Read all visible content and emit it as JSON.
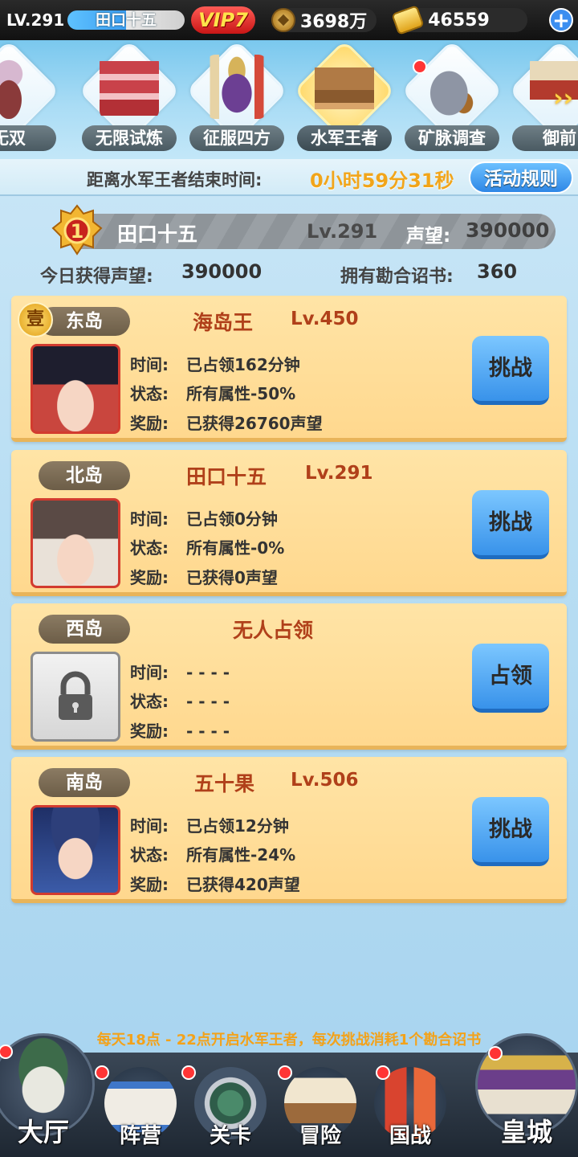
{
  "topbar": {
    "level": "LV.291",
    "player_name": "田口十五",
    "vip": "VIP7",
    "copper": "3698万",
    "gold": "46559",
    "plus": "+"
  },
  "carousel": {
    "items": [
      {
        "label": "无双"
      },
      {
        "label": "无限试炼"
      },
      {
        "label": "征服四方"
      },
      {
        "label": "水军王者"
      },
      {
        "label": "矿脉调查"
      },
      {
        "label": "御前"
      }
    ]
  },
  "timer": {
    "label": "距离水军王者结束时间:",
    "value": "0小时59分31秒",
    "rules_button": "活动规则"
  },
  "me": {
    "rank": "1",
    "name": "田口十五",
    "level": "Lv.291",
    "fame_label": "声望:",
    "fame": "390000",
    "today_label": "今日获得声望:",
    "today_value": "390000",
    "edict_label": "拥有勘合诏书:",
    "edict_value": "360"
  },
  "islands": [
    {
      "rank_coin": "壹",
      "name": "东岛",
      "owner": "海岛王",
      "owner_level": "Lv.450",
      "time_label": "时间:",
      "time": "已占领162分钟",
      "status_label": "状态:",
      "status": "所有属性-50%",
      "reward_label": "奖励:",
      "reward": "已获得26760声望",
      "button": "挑战"
    },
    {
      "name": "北岛",
      "owner": "田口十五",
      "owner_level": "Lv.291",
      "time_label": "时间:",
      "time": "已占领0分钟",
      "status_label": "状态:",
      "status": "所有属性-0%",
      "reward_label": "奖励:",
      "reward": "已获得0声望",
      "button": "挑战"
    },
    {
      "name": "西岛",
      "owner": "无人占领",
      "time_label": "时间:",
      "time": "- - - -",
      "status_label": "状态:",
      "status": "- - - -",
      "reward_label": "奖励:",
      "reward": "- - - -",
      "button": "占领"
    },
    {
      "name": "南岛",
      "owner": "五十果",
      "owner_level": "Lv.506",
      "time_label": "时间:",
      "time": "已占领12分钟",
      "status_label": "状态:",
      "status": "所有属性-24%",
      "reward_label": "奖励:",
      "reward": "已获得420声望",
      "button": "挑战"
    }
  ],
  "notice": "每天18点 - 22点开启水军王者，每次挑战消耗1个勘合诏书",
  "nav": [
    {
      "label": "大厅"
    },
    {
      "label": "阵营"
    },
    {
      "label": "关卡"
    },
    {
      "label": "冒险"
    },
    {
      "label": "国战"
    },
    {
      "label": "皇城"
    }
  ],
  "colors": {
    "accent_gold": "#f1a51b",
    "button_blue": "#3892ea",
    "card_bg": "#ffd88e",
    "owner_red": "#b0401a"
  }
}
